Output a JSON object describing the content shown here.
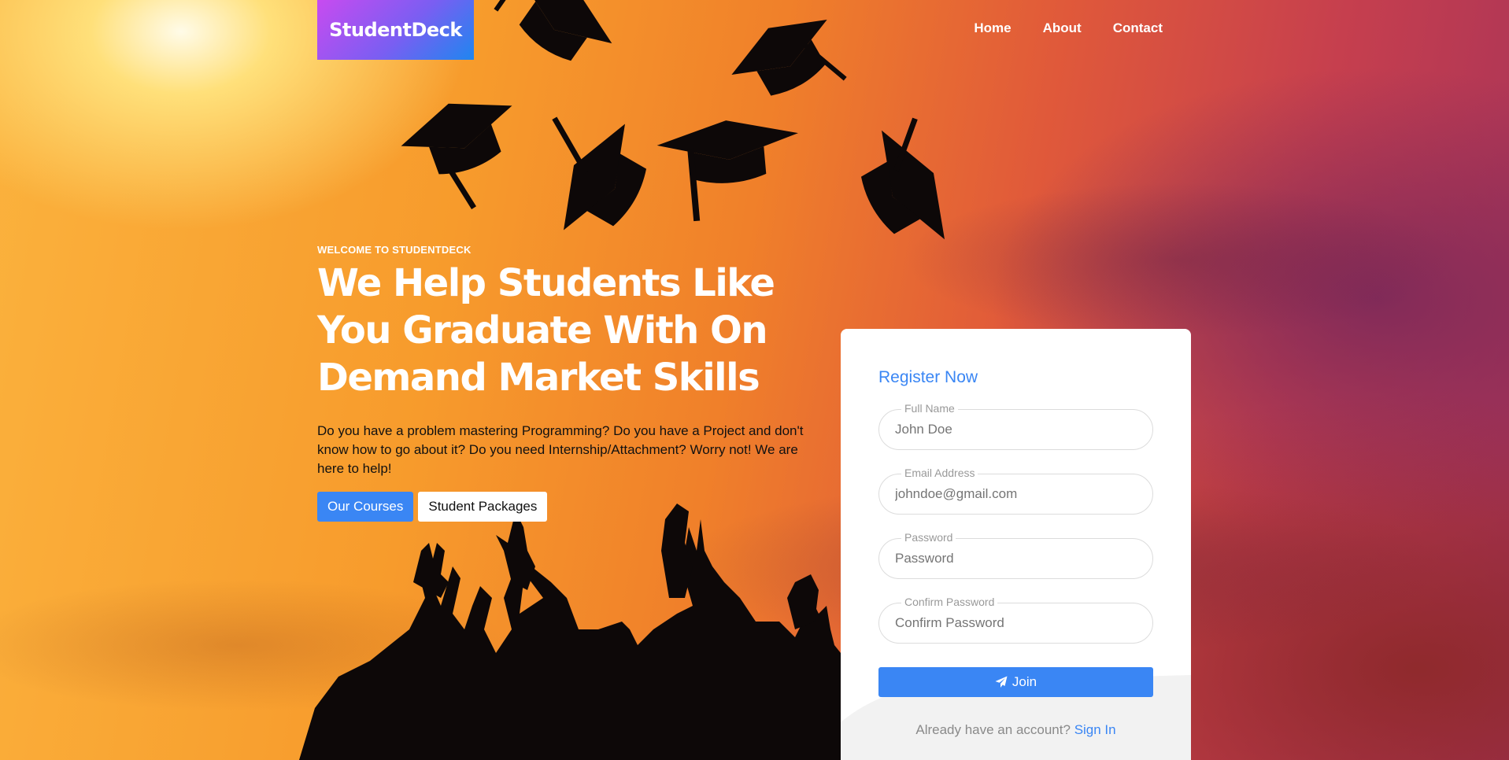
{
  "brand": {
    "name": "StudentDeck"
  },
  "nav": {
    "home": "Home",
    "about": "About",
    "contact": "Contact"
  },
  "hero": {
    "eyebrow": "WELCOME TO STUDENTDECK",
    "headline": "We Help Students Like You Graduate With On Demand Market Skills",
    "lead": "Do you have a problem mastering Programming? Do you have a Project and don't know how to go about it? Do you need Internship/Attachment? Worry not! We are here to help!",
    "primary_button": "Our Courses",
    "secondary_button": "Student Packages"
  },
  "register": {
    "title": "Register Now",
    "full_name": {
      "label": "Full Name",
      "placeholder": "John Doe"
    },
    "email": {
      "label": "Email Address",
      "placeholder": "johndoe@gmail.com"
    },
    "password": {
      "label": "Password",
      "placeholder": "Password"
    },
    "confirm_password": {
      "label": "Confirm Password",
      "placeholder": "Confirm Password"
    },
    "join_button": "Join",
    "signin_prompt": "Already have an account?",
    "signin_link": "Sign In"
  },
  "colors": {
    "accent": "#3a86f4",
    "brand_gradient_start": "#c84bf0",
    "brand_gradient_end": "#1f86ef"
  },
  "icons": {
    "join_icon": "paper-plane-icon"
  }
}
